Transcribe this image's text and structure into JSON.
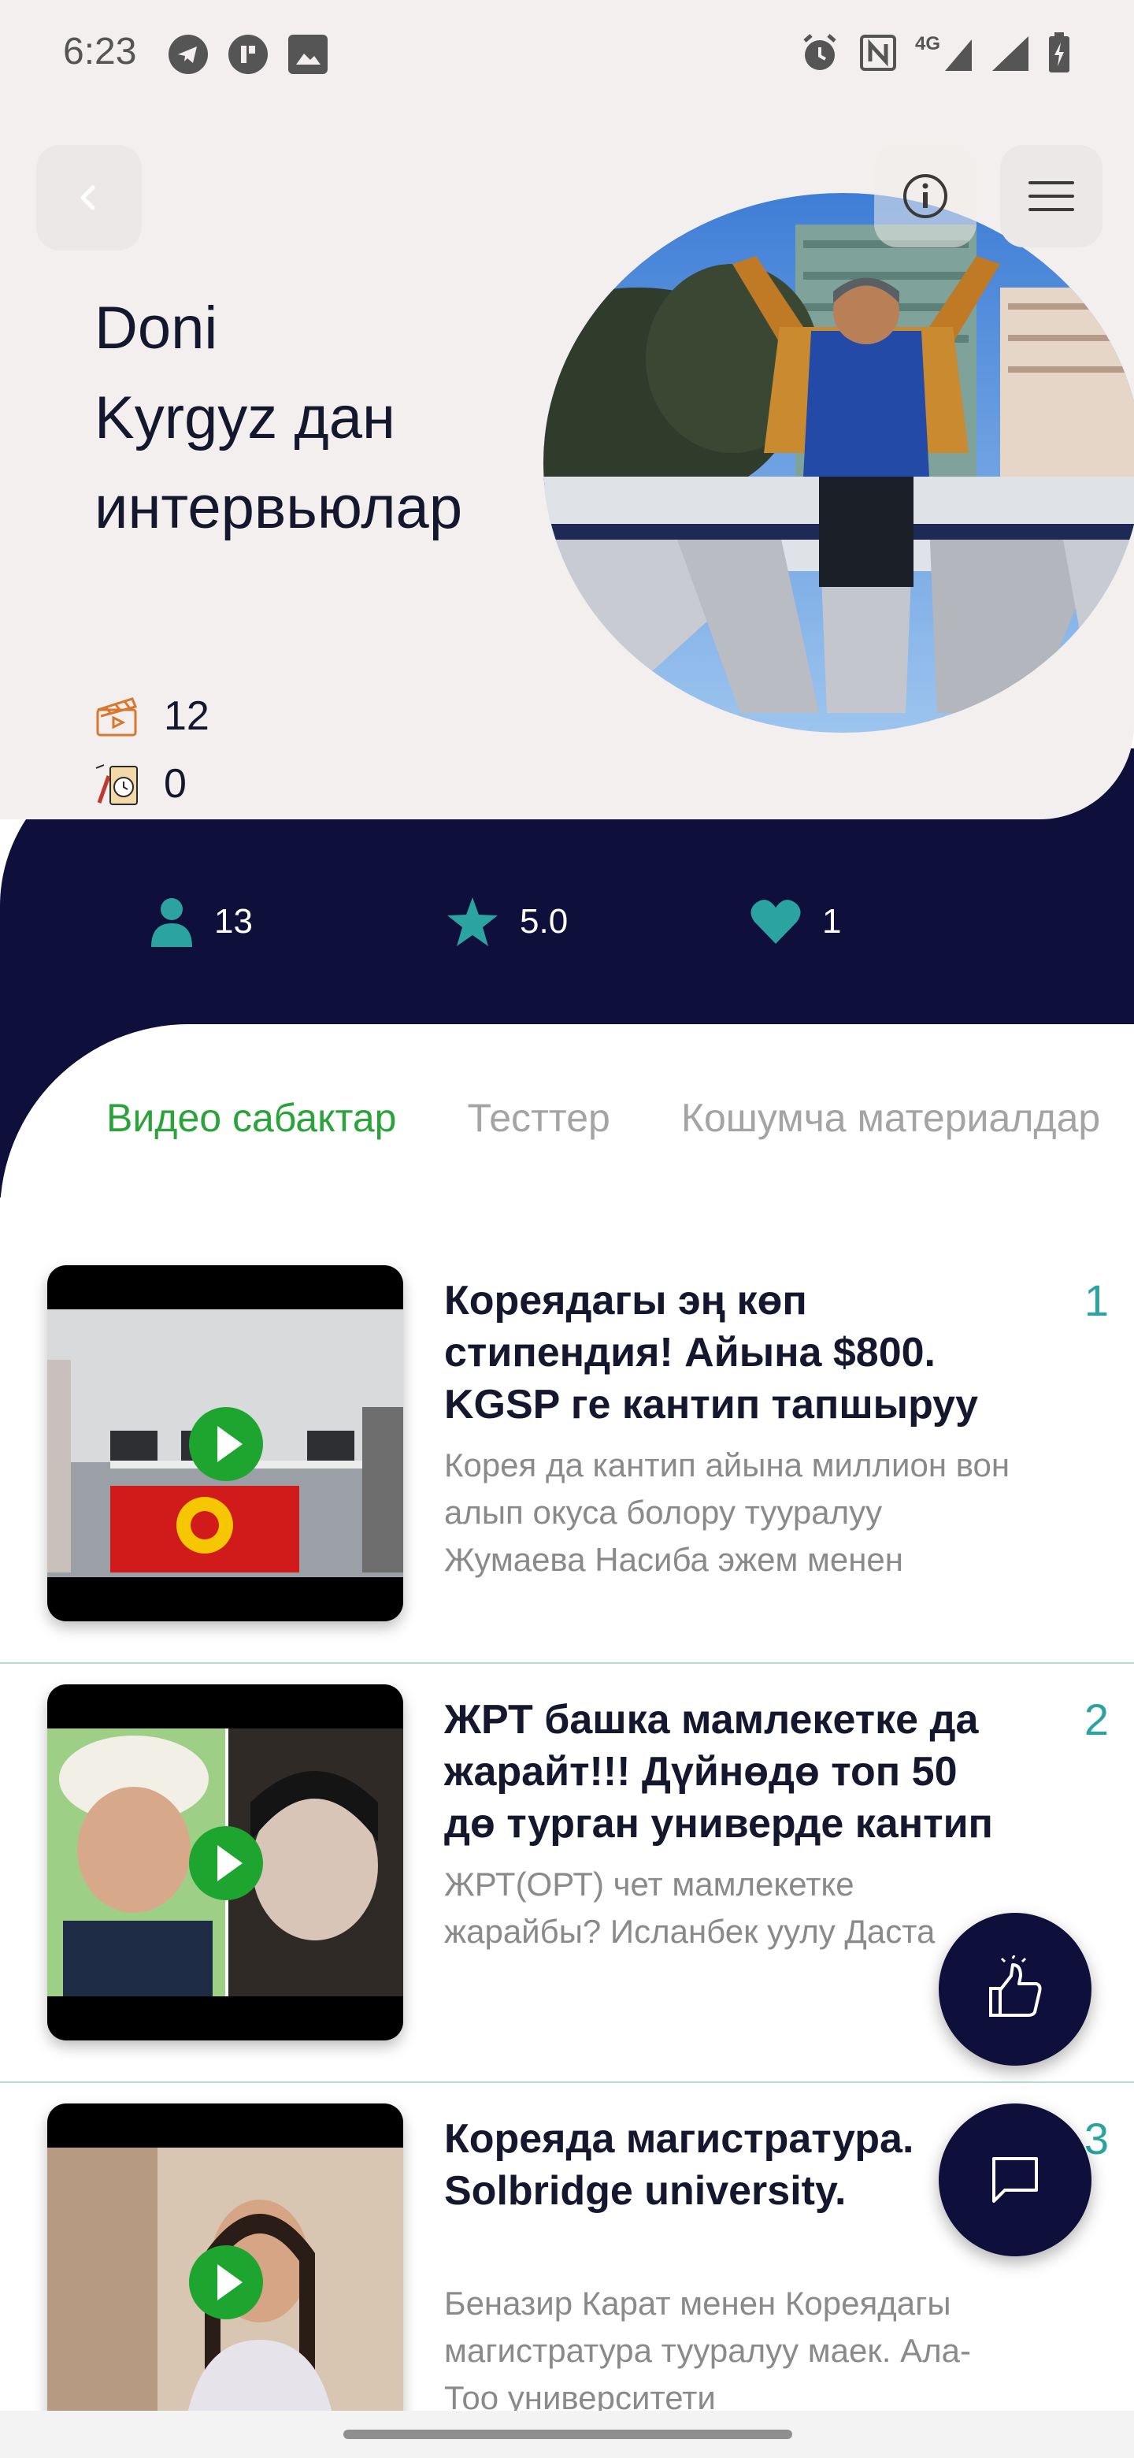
{
  "status_bar": {
    "time": "6:23",
    "left_icons": [
      "telegram-icon",
      "app-icon",
      "image-icon"
    ],
    "right_icons": [
      "alarm-icon",
      "nfc-icon",
      "network-4g-icon",
      "signal-icon",
      "battery-charging-icon"
    ],
    "network_label": "4G"
  },
  "header": {
    "title_lines": [
      "Doni",
      "Kyrgyz дан",
      "интервьюлар"
    ],
    "counts": [
      {
        "icon": "video-clapper-icon",
        "value": "12"
      },
      {
        "icon": "test-timer-icon",
        "value": "0"
      }
    ]
  },
  "stats": {
    "subscribers": "13",
    "rating": "5.0",
    "likes": "1"
  },
  "tabs": [
    {
      "label": "Видео сабактар",
      "active": true
    },
    {
      "label": "Тесттер",
      "active": false
    },
    {
      "label": "Кошумча материалдар",
      "active": false
    }
  ],
  "items": [
    {
      "number": "1",
      "title": "Кореядагы эң көп стипендия! Айына $800. KGSP ге кантип тапшыруу",
      "description": "Корея да кантип айына миллион вон алып окуса болору тууралуу Жумаева Насиба эжем менен"
    },
    {
      "number": "2",
      "title": "ЖРТ башка мамлекетке да жарайт!!! Дүйнөдө топ 50 дө турган универде кантип",
      "description": "ЖРТ(ОРТ) чет мамлекетке жарайбы? Исланбек уулу Даста"
    },
    {
      "number": "3",
      "title": "Кореяда магистратура. Solbridge university.",
      "description": "Беназир Карат менен Кореядагы магистратура тууралуу маек. Ала-Тоо университети"
    }
  ],
  "colors": {
    "accent_green": "#2aa33a",
    "teal": "#2aa3a1",
    "navy": "#0e0f3a",
    "hero_bg": "#f3efee"
  }
}
